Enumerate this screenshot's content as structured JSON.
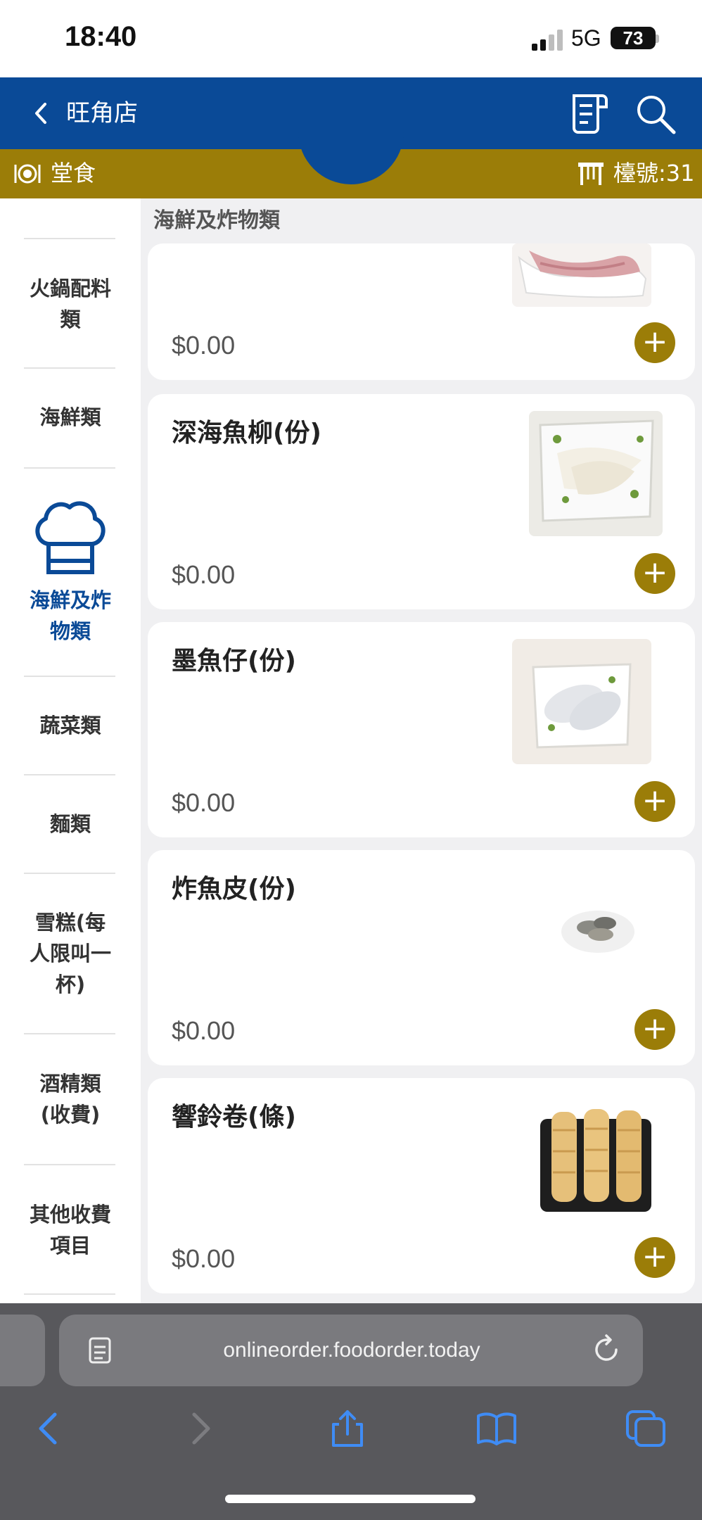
{
  "status": {
    "time": "18:40",
    "network": "5G",
    "battery": "73"
  },
  "header": {
    "title": "旺角店"
  },
  "subbar": {
    "mode": "堂食",
    "table": "檯號:31"
  },
  "sidebar": {
    "items": [
      {
        "label": "火鍋配料類"
      },
      {
        "label": "海鮮類"
      },
      {
        "label": "海鮮及炸物類",
        "active": true
      },
      {
        "label": "蔬菜類"
      },
      {
        "label": "麵類"
      },
      {
        "label": "雪糕(每人限叫一杯)"
      },
      {
        "label": "酒精類(收費)"
      },
      {
        "label": "其他收費項目"
      }
    ]
  },
  "section": {
    "title": "海鮮及炸物類"
  },
  "items": [
    {
      "name": "",
      "price": "$0.00",
      "image": "fish-slices-photo"
    },
    {
      "name": "深海魚柳(份)",
      "price": "$0.00",
      "image": "fish-fillet-photo"
    },
    {
      "name": "墨魚仔(份)",
      "price": "$0.00",
      "image": "baby-cuttlefish-photo"
    },
    {
      "name": "炸魚皮(份)",
      "price": "$0.00",
      "image": "fried-fish-skin-photo"
    },
    {
      "name": "響鈴卷(條)",
      "price": "$0.00",
      "image": "beancurd-roll-photo"
    }
  ],
  "add_label": "+",
  "browser": {
    "url": "onlineorder.foodorder.today"
  },
  "colors": {
    "brand_blue": "#0a4a97",
    "gold": "#9b7d08"
  }
}
